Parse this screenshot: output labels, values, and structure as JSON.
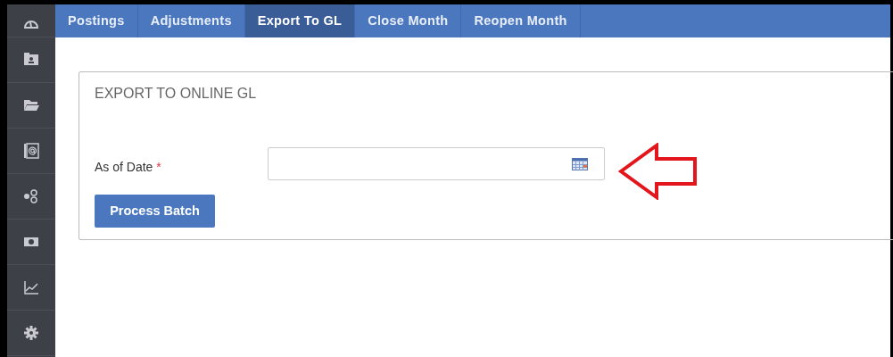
{
  "tabs": [
    {
      "label": "Postings",
      "selected": false
    },
    {
      "label": "Adjustments",
      "selected": false
    },
    {
      "label": "Export To GL",
      "selected": true
    },
    {
      "label": "Close Month",
      "selected": false
    },
    {
      "label": "Reopen Month",
      "selected": false
    }
  ],
  "panel": {
    "title": "EXPORT TO ONLINE GL",
    "field": {
      "label": "As of Date",
      "required_mark": "*"
    },
    "button": "Process Batch"
  }
}
